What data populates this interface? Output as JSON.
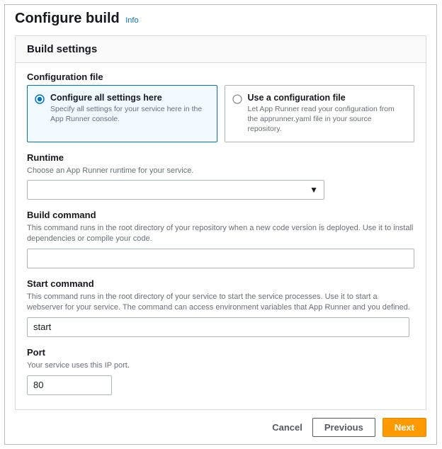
{
  "header": {
    "title": "Configure build",
    "info_label": "Info"
  },
  "panel": {
    "title": "Build settings"
  },
  "config_file": {
    "label": "Configuration file",
    "options": [
      {
        "title": "Configure all settings here",
        "desc": "Specify all settings for your service here in the App Runner console.",
        "selected": true
      },
      {
        "title": "Use a configuration file",
        "desc": "Let App Runner read your configuration from the apprunner.yaml file in your source repository.",
        "selected": false
      }
    ]
  },
  "runtime": {
    "label": "Runtime",
    "desc": "Choose an App Runner runtime for your service.",
    "value": ""
  },
  "build_command": {
    "label": "Build command",
    "desc": "This command runs in the root directory of your repository when a new code version is deployed. Use it to install dependencies or compile your code.",
    "value": ""
  },
  "start_command": {
    "label": "Start command",
    "desc": "This command runs in the root directory of your service to start the service processes. Use it to start a webserver for your service. The command can access environment variables that App Runner and you defined.",
    "value": "start"
  },
  "port": {
    "label": "Port",
    "desc": "Your service uses this IP port.",
    "value": "80"
  },
  "footer": {
    "cancel": "Cancel",
    "previous": "Previous",
    "next": "Next"
  }
}
